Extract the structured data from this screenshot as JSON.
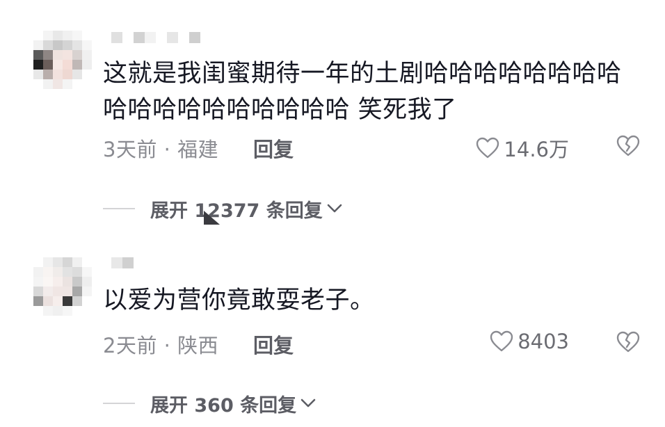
{
  "comments": [
    {
      "text": "这就是我闺蜜期待一年的土剧哈哈哈哈哈哈哈哈哈哈哈哈哈哈哈哈哈哈 笑死我了",
      "time_location": "3天前 · 福建",
      "reply_label": "回复",
      "like_count": "14.6万",
      "expand_label": "展开 12377 条回复"
    },
    {
      "text": "以爱为营你竟敢耍老子。",
      "time_location": "2天前 · 陕西",
      "reply_label": "回复",
      "like_count": "8403",
      "expand_label": "展开 360 条回复"
    }
  ],
  "colors": {
    "text_primary": "#161823",
    "text_meta": "#8a8b91",
    "text_action": "#5c5d64",
    "divider": "#d4d4d6"
  },
  "icons": {
    "like": "heart-outline-icon",
    "dislike": "broken-heart-icon",
    "expand": "chevron-down-icon",
    "cursor": "mouse-pointer-icon"
  }
}
